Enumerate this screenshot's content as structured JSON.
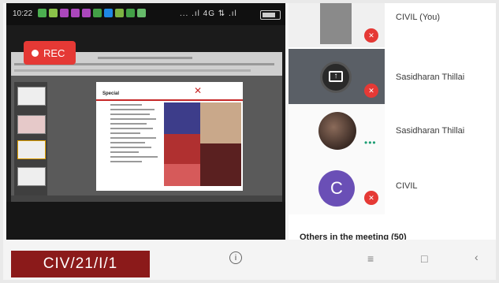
{
  "status_bar": {
    "time": "10:22",
    "right_text": "... .ıl 4G ⇅ .ıl"
  },
  "recording": {
    "label": "REC"
  },
  "slide": {
    "title": "Special"
  },
  "participants": [
    {
      "name": "CIVIL (You)"
    },
    {
      "name": "Sasidharan Thillai"
    },
    {
      "name": "Sasidharan Thillai"
    },
    {
      "name": "CIVIL",
      "initial": "C"
    }
  ],
  "others_label": "Others in the meeting (50)",
  "slide_code": "CIV/21/I/1",
  "nav": {
    "info_icon": "info-icon",
    "menu_icon": "menu-icon",
    "home_icon": "square-icon",
    "back_icon": "back-chevron-icon"
  },
  "colors": {
    "rec": "#e53935",
    "avatar": "#6a4fb6",
    "code_bg": "#8b1a1a",
    "mute": "#e53935",
    "active_dots": "#1e9e74"
  }
}
